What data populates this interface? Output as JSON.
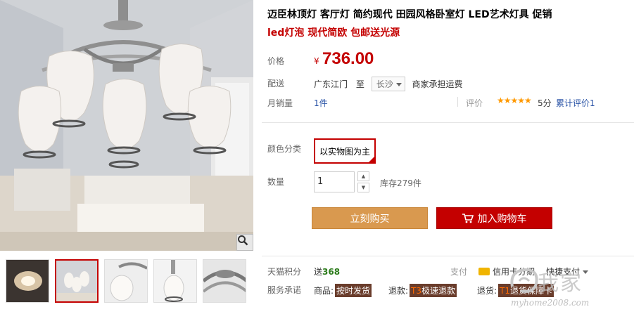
{
  "product": {
    "title": "迈臣林顶灯 客厅灯 简约现代 田园风格卧室灯 LED艺术灯具 促销",
    "subtitle": "led灯泡 现代简欧 包邮送光源"
  },
  "price": {
    "label": "价格",
    "currency": "¥",
    "value": "736.00"
  },
  "shipping": {
    "label": "配送",
    "from": "广东江门",
    "to_word": "至",
    "city": "长沙",
    "note": "商家承担运费"
  },
  "sales": {
    "label": "月销量",
    "value": "1件"
  },
  "rating": {
    "label": "评价",
    "stars": "★★★★★",
    "score": "5分",
    "reviews": "累计评价1"
  },
  "sku": {
    "label": "颜色分类",
    "option": "以实物图为主"
  },
  "quantity": {
    "label": "数量",
    "value": "1",
    "stock": "库存279件",
    "up": "▲",
    "down": "▼"
  },
  "actions": {
    "buy": "立刻购买",
    "cart": "加入购物车"
  },
  "points": {
    "label": "天猫积分",
    "prefix": "送",
    "value": "368"
  },
  "payment": {
    "label": "支付",
    "card": "信用卡分期",
    "quick": "快捷支付"
  },
  "service": {
    "label": "服务承诺",
    "items": [
      {
        "name": "商品:",
        "tag": "按时发货",
        "code": ""
      },
      {
        "name": "退款:",
        "tag": "极速退款",
        "code": "T3"
      },
      {
        "name": "退货:",
        "tag": "退货保障卡",
        "code": "T1"
      }
    ]
  },
  "watermark": {
    "text": "我家",
    "url": "myhome2008.com"
  },
  "colors": {
    "accent": "#c40000",
    "buy": "#d9994f",
    "link": "#2953a6",
    "stars": "#ff9900"
  },
  "icons": {
    "zoom": "zoom-icon",
    "cart": "cart-icon",
    "card": "card-icon"
  }
}
